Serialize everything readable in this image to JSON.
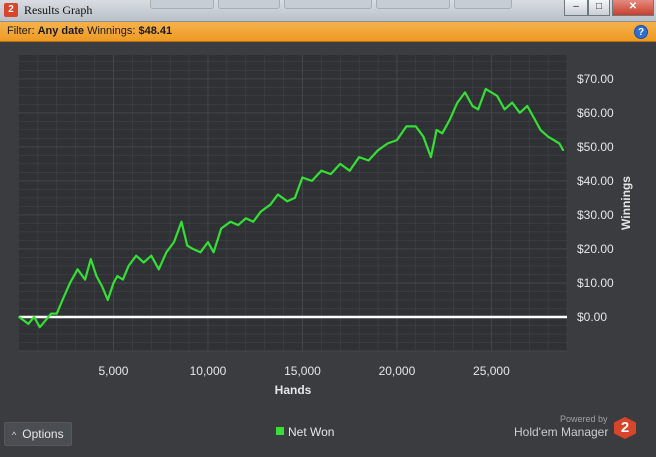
{
  "window": {
    "title": "Results Graph",
    "app_icon_text": "2",
    "controls": {
      "minimize": "–",
      "maximize": "□",
      "close": "✕"
    }
  },
  "filter": {
    "label": "Filter:",
    "date_value": "Any date",
    "winnings_label": "Winnings:",
    "winnings_value": "$48.41",
    "help_icon": "?"
  },
  "footer": {
    "options_label": "Options",
    "options_icon": "chevron-up-icon",
    "powered_by": "Powered by",
    "brand": "Hold'em Manager",
    "brand_icon_text": "2"
  },
  "colors": {
    "plot_bg": "#2f3135",
    "grid": "#44474b",
    "series": "#35e035",
    "zero_line": "#ffffff",
    "text": "#e6e6e6",
    "filter_bar": "#f2a533"
  },
  "chart_data": {
    "type": "line",
    "title": "",
    "xlabel": "Hands",
    "ylabel": "Winnings",
    "xlim": [
      0,
      29000
    ],
    "ylim": [
      -10,
      77
    ],
    "x_ticks": [
      5000,
      10000,
      15000,
      20000,
      25000
    ],
    "x_tick_labels": [
      "5,000",
      "10,000",
      "15,000",
      "20,000",
      "25,000"
    ],
    "y_ticks": [
      0,
      10,
      20,
      30,
      40,
      50,
      60,
      70
    ],
    "y_tick_labels": [
      "$0.00",
      "$10.00",
      "$20.00",
      "$30.00",
      "$40.00",
      "$50.00",
      "$60.00",
      "$70.00"
    ],
    "grid": true,
    "legend_position": "bottom-center",
    "series": [
      {
        "name": "Net Won",
        "x": [
          0,
          500,
          800,
          1100,
          1400,
          1700,
          2000,
          2300,
          2700,
          3100,
          3500,
          3800,
          4100,
          4400,
          4700,
          5000,
          5200,
          5500,
          5800,
          6200,
          6600,
          7000,
          7400,
          7800,
          8200,
          8600,
          8900,
          9200,
          9600,
          10000,
          10300,
          10700,
          11200,
          11600,
          12000,
          12400,
          12800,
          13300,
          13700,
          14200,
          14600,
          15000,
          15500,
          16000,
          16500,
          17000,
          17500,
          18000,
          18500,
          19000,
          19500,
          20000,
          20500,
          21000,
          21400,
          21800,
          22100,
          22400,
          22800,
          23200,
          23600,
          24000,
          24300,
          24700,
          25000,
          25300,
          25700,
          26100,
          26500,
          26900,
          27300,
          27600,
          28000,
          28300,
          28600,
          28800
        ],
        "values": [
          0,
          -2,
          0,
          -3,
          -1,
          1,
          1,
          5,
          10,
          14,
          11,
          17,
          12,
          9,
          5,
          10,
          12,
          11,
          15,
          18,
          16,
          18,
          14,
          19,
          22,
          28,
          21,
          20,
          19,
          22,
          19,
          26,
          28,
          27,
          29,
          28,
          31,
          33,
          36,
          34,
          35,
          41,
          40,
          43,
          42,
          45,
          43,
          47,
          46,
          49,
          51,
          52,
          56,
          56,
          53,
          47,
          55,
          54,
          58,
          63,
          66,
          62,
          61,
          67,
          66,
          65,
          61,
          63,
          60,
          62,
          58,
          55,
          53,
          52,
          51,
          49
        ]
      }
    ]
  }
}
